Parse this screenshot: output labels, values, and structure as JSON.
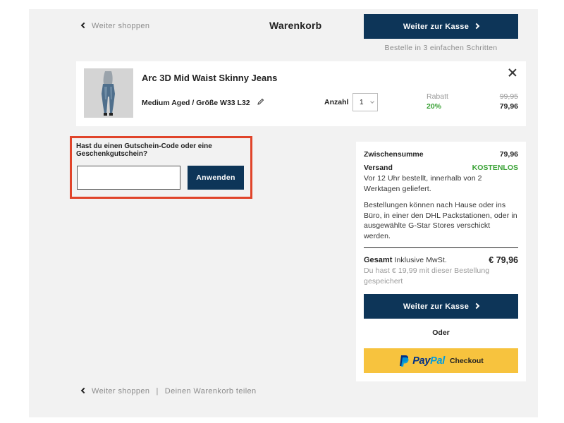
{
  "header": {
    "back_label": "Weiter shoppen",
    "title": "Warenkorb",
    "checkout_label": "Weiter zur Kasse",
    "steps_text": "Bestelle in 3 einfachen Schritten"
  },
  "product": {
    "name": "Arc 3D Mid Waist Skinny Jeans",
    "variant": "Medium Aged / Größe W33 L32",
    "qty_label": "Anzahl",
    "qty_value": "1",
    "discount_label": "Rabatt",
    "discount_value": "20%",
    "price_old": "99,95",
    "price_new": "79,96"
  },
  "voucher": {
    "title": "Hast du einen Gutschein-Code oder eine Geschenkgutschein?",
    "input_placeholder": "",
    "apply_label": "Anwenden"
  },
  "summary": {
    "subtotal_label": "Zwischensumme",
    "subtotal_value": "79,96",
    "shipping_label": "Versand",
    "shipping_value": "KOSTENLOS",
    "shipping_note": "Vor 12 Uhr bestellt, innerhalb von 2 Werktagen geliefert.",
    "delivery_note": "Bestellungen können nach Hause oder ins Büro, in einer den DHL Packstationen, oder in ausgewählte G-Star Stores verschickt werden.",
    "total_label": "Gesamt",
    "total_vat": "Inklusive MwSt.",
    "total_value": "€ 79,96",
    "savings_note": "Du hast € 19,99 mit dieser Bestellung gespeichert",
    "checkout_label": "Weiter zur Kasse",
    "or_label": "Oder",
    "paypal_pay": "Pay",
    "paypal_pal": "Pal",
    "paypal_checkout": "Checkout"
  },
  "footer": {
    "back_label": "Weiter shoppen",
    "separator": "|",
    "share_label": "Deinen Warenkorb teilen"
  },
  "colors": {
    "primary": "#0d3558",
    "success": "#3aa236",
    "highlight": "#e0442a",
    "paypal_bg": "#f7c33e"
  }
}
